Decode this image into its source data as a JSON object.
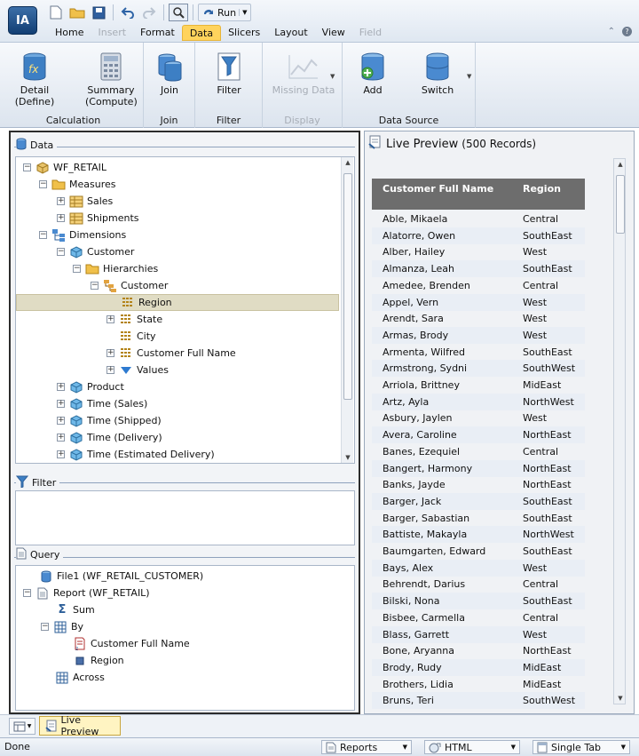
{
  "app": {
    "logo_text": "IA"
  },
  "qat": {
    "run_label": "Run"
  },
  "menu_tabs": [
    {
      "label": "Home",
      "state": "normal"
    },
    {
      "label": "Insert",
      "state": "disabled"
    },
    {
      "label": "Format",
      "state": "normal"
    },
    {
      "label": "Data",
      "state": "active"
    },
    {
      "label": "Slicers",
      "state": "normal"
    },
    {
      "label": "Layout",
      "state": "normal"
    },
    {
      "label": "View",
      "state": "normal"
    },
    {
      "label": "Field",
      "state": "disabled"
    }
  ],
  "ribbon": {
    "calculation": {
      "label": "Calculation",
      "detail_1": "Detail",
      "detail_2": "(Define)",
      "summary_1": "Summary",
      "summary_2": "(Compute)"
    },
    "join": {
      "label": "Join",
      "button": "Join"
    },
    "filter": {
      "label": "Filter",
      "button": "Filter"
    },
    "display": {
      "label": "Display",
      "button": "Missing Data"
    },
    "datasource": {
      "label": "Data Source",
      "add": "Add",
      "switch": "Switch"
    }
  },
  "data_panel": {
    "title": "Data",
    "tree": [
      {
        "label": "WF_RETAIL"
      },
      {
        "label": "Measures"
      },
      {
        "label": "Sales"
      },
      {
        "label": "Shipments"
      },
      {
        "label": "Dimensions"
      },
      {
        "label": "Customer"
      },
      {
        "label": "Hierarchies"
      },
      {
        "label": "Customer"
      },
      {
        "label": "Region"
      },
      {
        "label": "State"
      },
      {
        "label": "City"
      },
      {
        "label": "Customer Full Name"
      },
      {
        "label": "Values"
      },
      {
        "label": "Product"
      },
      {
        "label": "Time (Sales)"
      },
      {
        "label": "Time (Shipped)"
      },
      {
        "label": "Time (Delivery)"
      },
      {
        "label": "Time (Estimated Delivery)"
      }
    ]
  },
  "filter_panel": {
    "title": "Filter"
  },
  "query_panel": {
    "title": "Query",
    "tree": [
      {
        "label": "File1 (WF_RETAIL_CUSTOMER)"
      },
      {
        "label": "Report (WF_RETAIL)"
      },
      {
        "label": "Sum"
      },
      {
        "label": "By"
      },
      {
        "label": "Customer Full Name"
      },
      {
        "label": "Region"
      },
      {
        "label": "Across"
      }
    ]
  },
  "preview": {
    "title": "Live Preview",
    "subtitle": "(500 Records)",
    "columns": [
      "Customer Full Name",
      "Region"
    ],
    "rows": [
      [
        "Able, Mikaela",
        "Central"
      ],
      [
        "Alatorre, Owen",
        "SouthEast"
      ],
      [
        "Alber, Hailey",
        "West"
      ],
      [
        "Almanza, Leah",
        "SouthEast"
      ],
      [
        "Amedee, Brenden",
        "Central"
      ],
      [
        "Appel, Vern",
        "West"
      ],
      [
        "Arendt, Sara",
        "West"
      ],
      [
        "Armas, Brody",
        "West"
      ],
      [
        "Armenta, Wilfred",
        "SouthEast"
      ],
      [
        "Armstrong, Sydni",
        "SouthWest"
      ],
      [
        "Arriola, Brittney",
        "MidEast"
      ],
      [
        "Artz, Ayla",
        "NorthWest"
      ],
      [
        "Asbury, Jaylen",
        "West"
      ],
      [
        "Avera, Caroline",
        "NorthEast"
      ],
      [
        "Banes, Ezequiel",
        "Central"
      ],
      [
        "Bangert, Harmony",
        "NorthEast"
      ],
      [
        "Banks, Jayde",
        "NorthEast"
      ],
      [
        "Barger, Jack",
        "SouthEast"
      ],
      [
        "Barger, Sabastian",
        "SouthEast"
      ],
      [
        "Battiste, Makayla",
        "NorthWest"
      ],
      [
        "Baumgarten, Edward",
        "SouthEast"
      ],
      [
        "Bays, Alex",
        "West"
      ],
      [
        "Behrendt, Darius",
        "Central"
      ],
      [
        "Bilski, Nona",
        "SouthEast"
      ],
      [
        "Bisbee, Carmella",
        "Central"
      ],
      [
        "Blass, Garrett",
        "West"
      ],
      [
        "Bone, Aryanna",
        "NorthEast"
      ],
      [
        "Brody, Rudy",
        "MidEast"
      ],
      [
        "Brothers, Lidia",
        "MidEast"
      ],
      [
        "Bruns, Teri",
        "SouthWest"
      ]
    ]
  },
  "bottom_tab": {
    "label": "Live Preview"
  },
  "status": {
    "text": "Done",
    "reports": "Reports",
    "format": "HTML",
    "tab_mode": "Single Tab"
  }
}
